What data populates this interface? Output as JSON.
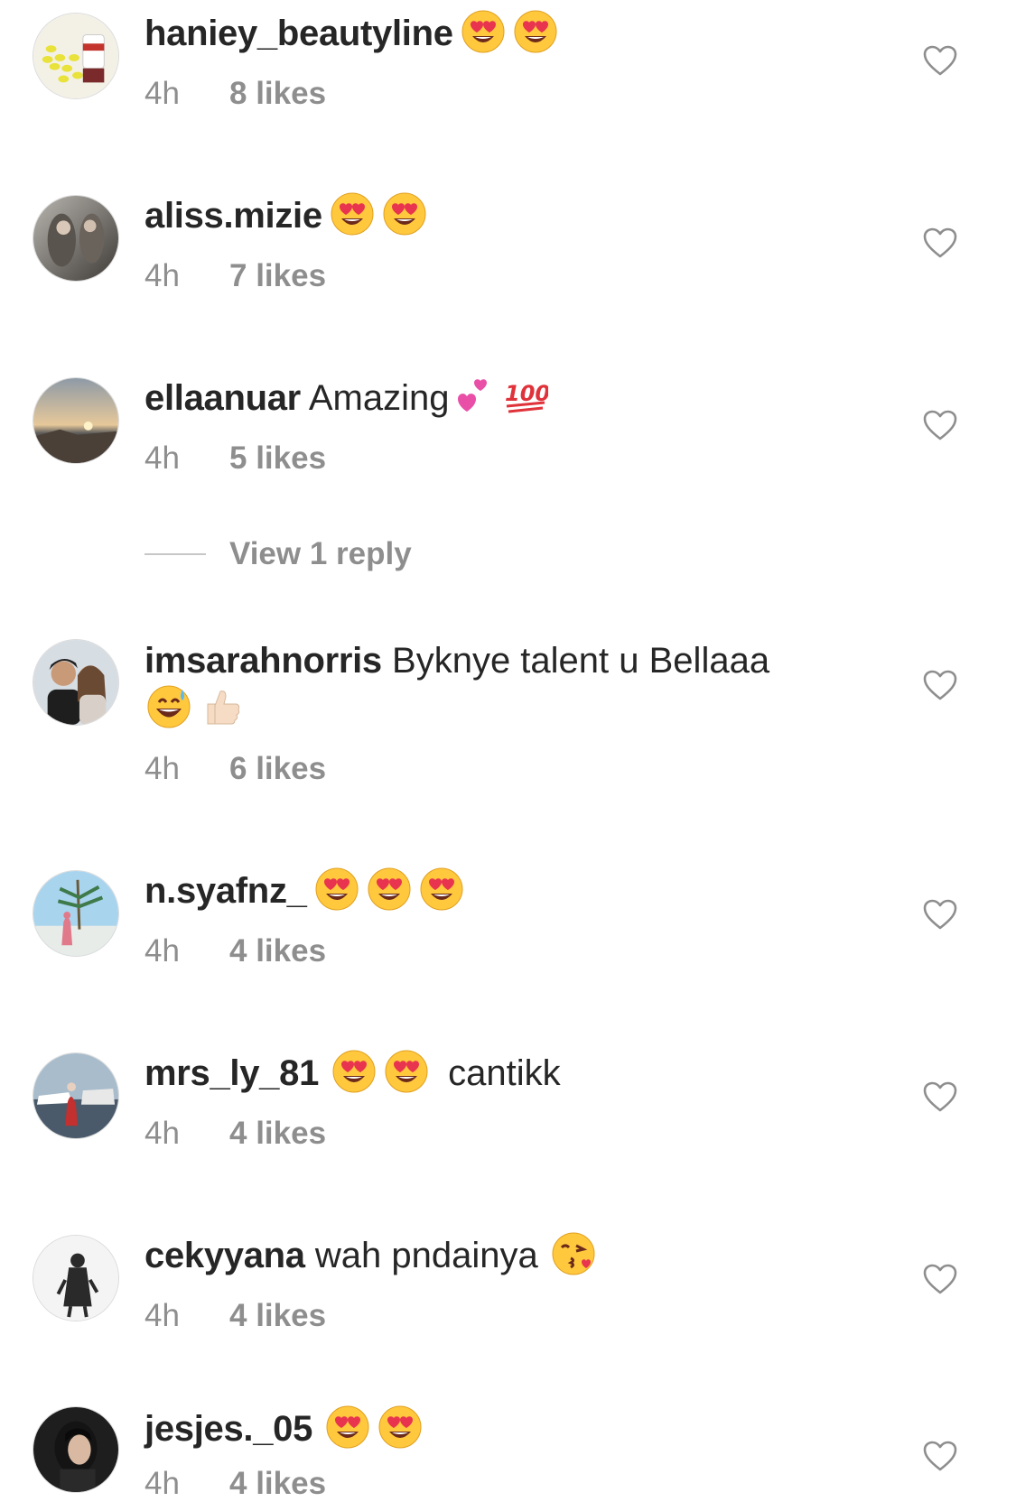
{
  "comments": [
    {
      "username": "haniey_beautyline",
      "text": "",
      "emojis": [
        "heart-eyes-emoji",
        "heart-eyes-emoji"
      ],
      "time": "4h",
      "likes": "8 likes"
    },
    {
      "username": "aliss.mizie",
      "text": "",
      "emojis": [
        "heart-eyes-emoji",
        "heart-eyes-emoji"
      ],
      "time": "4h",
      "likes": "7 likes"
    },
    {
      "username": "ellaanuar",
      "text": "Amazing",
      "emojis": [
        "two-hearts-emoji",
        "hundred-points-emoji"
      ],
      "time": "4h",
      "likes": "5 likes"
    },
    {
      "username": "imsarahnorris",
      "text": "Byknye talent u Bellaaa",
      "emojis": [
        "grinning-sweat-emoji",
        "thumbs-up-emoji"
      ],
      "time": "4h",
      "likes": "6 likes"
    },
    {
      "username": "n.syafnz_",
      "text": "",
      "emojis": [
        "heart-eyes-emoji",
        "heart-eyes-emoji",
        "heart-eyes-emoji"
      ],
      "time": "4h",
      "likes": "4 likes"
    },
    {
      "username": "mrs_ly_81",
      "text": "cantikk",
      "emojis": [
        "heart-eyes-emoji",
        "heart-eyes-emoji"
      ],
      "time": "4h",
      "likes": "4 likes"
    },
    {
      "username": "cekyyana",
      "text": "wah pndainya",
      "emojis": [
        "kissing-heart-emoji"
      ],
      "time": "4h",
      "likes": "4 likes"
    },
    {
      "username": "jesjes._05",
      "text": "",
      "emojis": [
        "heart-eyes-emoji",
        "heart-eyes-emoji"
      ],
      "time": "4h",
      "likes": "4 likes"
    }
  ],
  "view_replies_label": "View 1 reply",
  "colors": {
    "primary_text": "#262626",
    "secondary_text": "#8e8e8e",
    "divider": "#c7c7c7",
    "emoji_yellow": "#ffc83d",
    "emoji_heart": "#e8344e"
  }
}
